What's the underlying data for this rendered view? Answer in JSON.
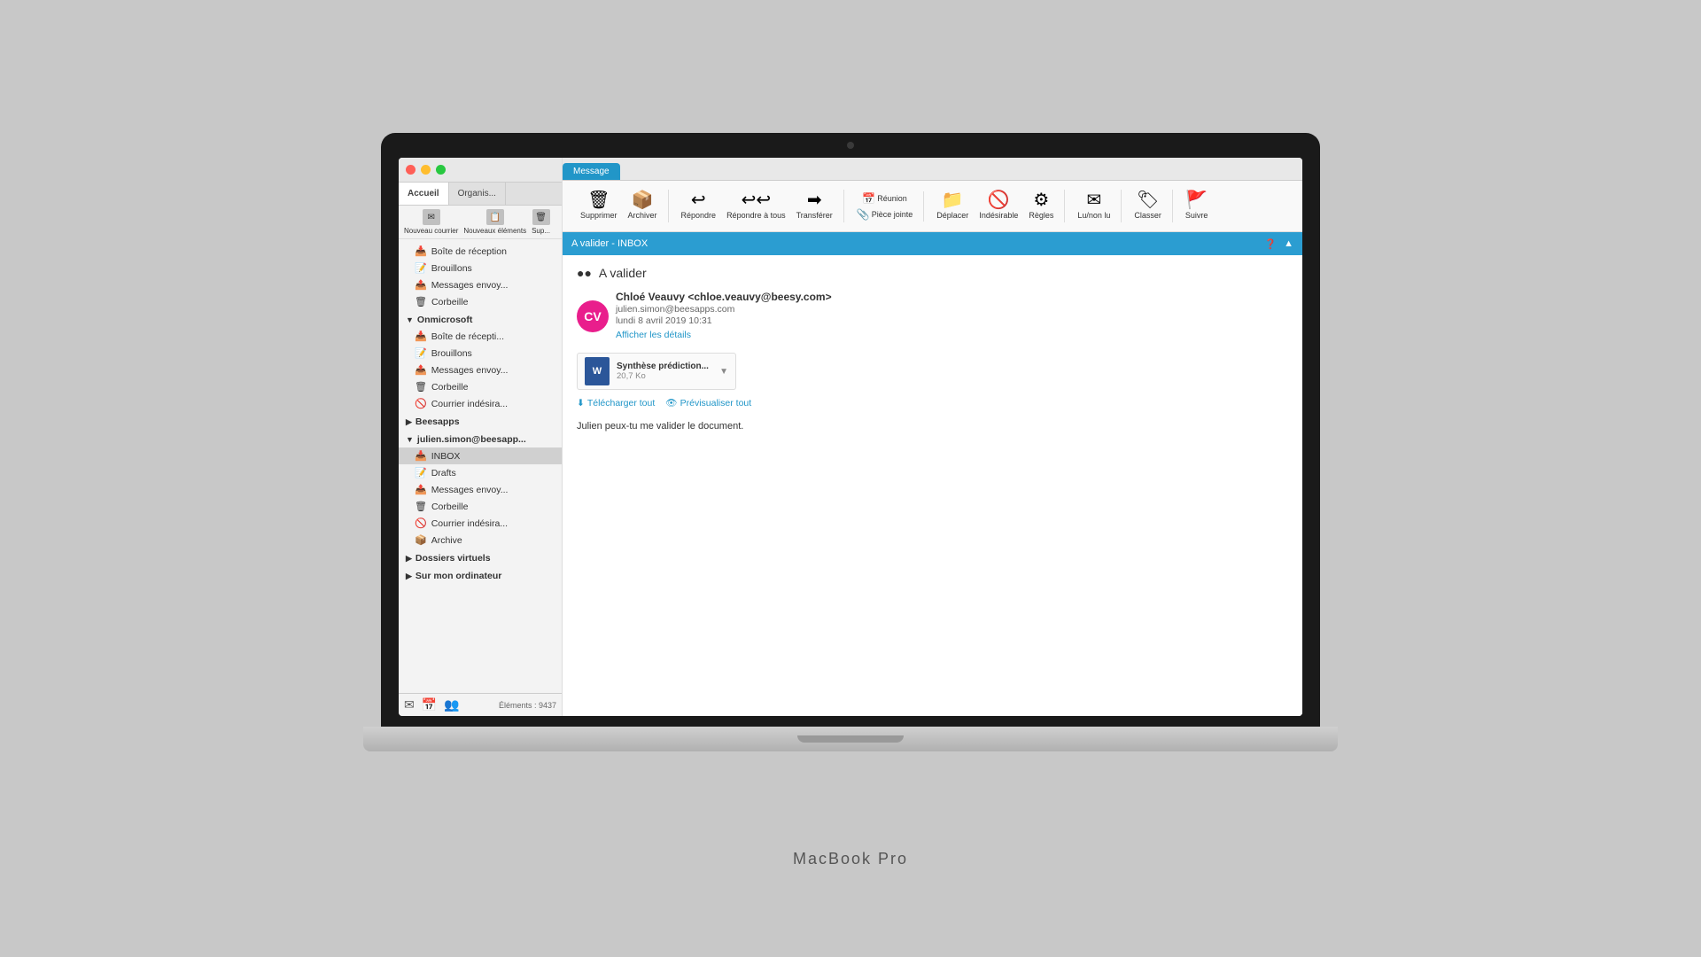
{
  "macbook": {
    "label": "MacBook Pro"
  },
  "window": {
    "title": "A valider  -  INBOX",
    "traffic_lights": [
      "close",
      "minimize",
      "maximize"
    ]
  },
  "sidebar_tabs": {
    "tab1": "Accueil",
    "tab2": "Organis..."
  },
  "sidebar_actions": {
    "btn1": "Nouveau courrier",
    "btn2": "Nouveaux éléments",
    "btn3": "Sup..."
  },
  "folders": {
    "default_section": {
      "items": [
        {
          "label": "Boîte de réception",
          "icon": "📥"
        },
        {
          "label": "Brouillons",
          "icon": "📝"
        },
        {
          "label": "Messages envoy...",
          "icon": "📤"
        },
        {
          "label": "Corbeille",
          "icon": "🗑"
        }
      ]
    },
    "onmicrosoft": {
      "header": "Onmicrosoft",
      "items": [
        {
          "label": "Boîte de récepti...",
          "icon": "📥"
        },
        {
          "label": "Brouillons",
          "icon": "📝"
        },
        {
          "label": "Messages envoy...",
          "icon": "📤"
        },
        {
          "label": "Corbeille",
          "icon": "🗑"
        },
        {
          "label": "Courrier indésira...",
          "icon": "🚫"
        }
      ]
    },
    "beesapps": {
      "header": "Beesapps",
      "items": []
    },
    "julien": {
      "header": "julien.simon@beesapp...",
      "items": [
        {
          "label": "INBOX",
          "icon": "📥",
          "selected": true
        },
        {
          "label": "Drafts",
          "icon": "📝"
        },
        {
          "label": "Messages envoy...",
          "icon": "📤"
        },
        {
          "label": "Corbeille",
          "icon": "🗑"
        },
        {
          "label": "Courrier indésira...",
          "icon": "🚫"
        },
        {
          "label": "Archive",
          "icon": "📦"
        }
      ]
    },
    "virtual": {
      "header": "Dossiers virtuels"
    },
    "local": {
      "header": "Sur mon ordinateur"
    }
  },
  "bottom_bar": {
    "count_label": "Éléments : 9437"
  },
  "ribbon": {
    "tabs": [
      "Message"
    ],
    "active_tab": "Message",
    "groups": {
      "delete_group": {
        "buttons": [
          {
            "label": "Supprimer",
            "icon": "🗑"
          },
          {
            "label": "Archiver",
            "icon": "📦"
          }
        ]
      },
      "respond_group": {
        "buttons": [
          {
            "label": "Répondre",
            "icon": "↩"
          },
          {
            "label": "Répondre à tous",
            "icon": "↩↩"
          },
          {
            "label": "Transférer",
            "icon": "➡"
          }
        ]
      },
      "meeting_group": {
        "top_btn": "Réunion",
        "bottom_btn": "Pièce jointe"
      },
      "move_group": {
        "buttons": [
          {
            "label": "Déplacer",
            "icon": "📁"
          },
          {
            "label": "Indésirable",
            "icon": "🚫"
          },
          {
            "label": "Règles",
            "icon": "⚙"
          }
        ]
      },
      "read_group": {
        "buttons": [
          {
            "label": "Lu/non lu",
            "icon": "✉"
          }
        ]
      },
      "classify_group": {
        "buttons": [
          {
            "label": "Classer",
            "icon": "🏷"
          }
        ]
      },
      "follow_group": {
        "buttons": [
          {
            "label": "Suivre",
            "icon": "🚩"
          }
        ]
      }
    }
  },
  "email": {
    "subject": "A valider",
    "sender_name": "Chloé Veauvy",
    "sender_email": "chloe.veauvy@beesy.com",
    "sender_display": "Chloé Veauvy <chloe.veauvy@beesy.com>",
    "to": "julien.simon@beesapps.com",
    "date": "lundi 8 avril 2019 10:31",
    "details_link": "Afficher les détails",
    "avatar_initials": "CV",
    "attachment": {
      "name": "Synthèse prédiction...",
      "size": "20,7 Ko",
      "type": "word"
    },
    "download_all": "Télécharger tout",
    "preview_all": "Prévisualiser tout",
    "body": "Julien peux-tu me valider le document."
  }
}
